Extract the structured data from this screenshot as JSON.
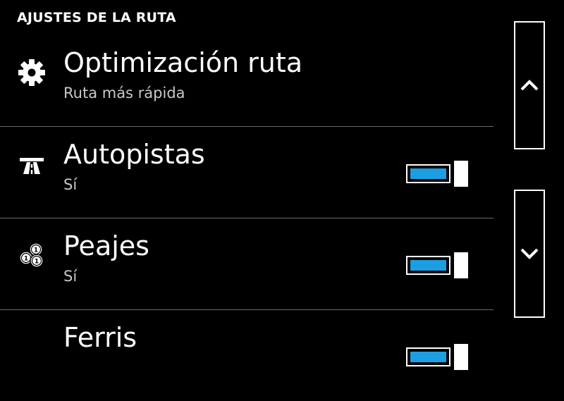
{
  "header": {
    "title": "AJUSTES DE LA RUTA"
  },
  "accent_color": "#1c9ee3",
  "rows": [
    {
      "title": "Optimización ruta",
      "subtitle": "Ruta más rápida",
      "icon": "gear-icon"
    },
    {
      "title": "Autopistas",
      "subtitle": "Sí",
      "icon": "highway-icon",
      "toggle_on": true
    },
    {
      "title": "Peajes",
      "subtitle": "Sí",
      "icon": "toll-coins-icon",
      "toggle_on": true
    },
    {
      "title": "Ferris",
      "icon": "ferry-icon",
      "toggle_on": true
    }
  ],
  "scroll": {
    "up_icon": "chevron-up-icon",
    "down_icon": "chevron-down-icon"
  }
}
